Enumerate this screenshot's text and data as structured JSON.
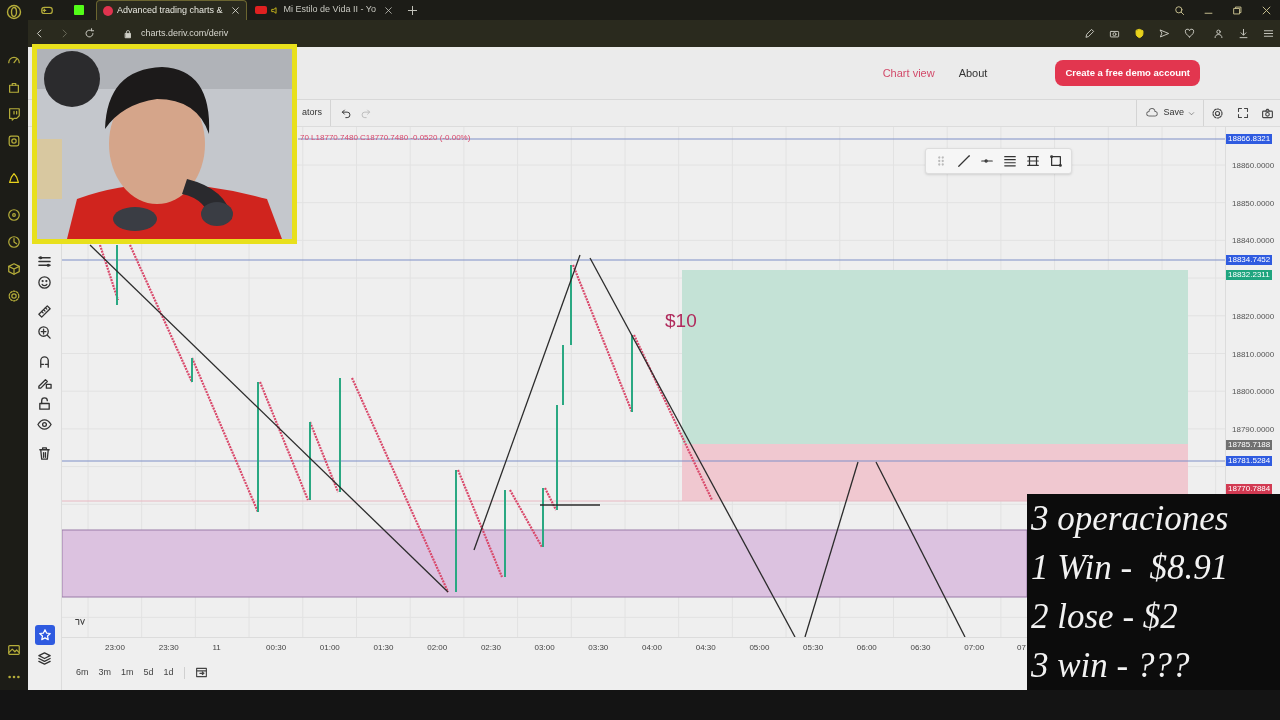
{
  "browser": {
    "tabs": [
      {
        "title": "Advanced trading charts &",
        "selected": true
      },
      {
        "title": "Mi Estilo de Vida II - Yo",
        "selected": false
      }
    ],
    "url": "charts.deriv.com/deriv"
  },
  "header": {
    "nav": [
      {
        "label": "Chart view",
        "selected": true
      },
      {
        "label": "About",
        "selected": false
      }
    ],
    "cta": "Create a free demo account"
  },
  "toolbar": {
    "indicators_label": "ators",
    "save_label": "Save"
  },
  "ohlc_text": "70 L18770.7480 C18770.7480 -0.0520 (-0.00%)",
  "chart": {
    "annotation": "$10",
    "price_ticks": [
      "18860.0000",
      "18850.0000",
      "18840.0000",
      "18820.0000",
      "18810.0000",
      "18800.0000",
      "18790.0000"
    ],
    "price_badges": [
      {
        "text": "18866.8321",
        "color": "#2f5be0"
      },
      {
        "text": "18834.7452",
        "color": "#2f5be0"
      },
      {
        "text": "18832.2311",
        "color": "#1fa57f"
      },
      {
        "text": "18785.7188",
        "color": "#707070"
      },
      {
        "text": "18781.5284",
        "color": "#2f5be0"
      },
      {
        "text": "18770.7884",
        "color": "#d23a52"
      }
    ],
    "time_ticks": [
      "23:00",
      "23:30",
      "11",
      "00:30",
      "01:00",
      "01:30",
      "02:00",
      "02:30",
      "03:00",
      "03:30",
      "04:00",
      "04:30",
      "05:00",
      "05:30",
      "06:00",
      "06:30",
      "07:00",
      "07"
    ]
  },
  "timeframes": [
    "6m",
    "3m",
    "1m",
    "5d",
    "1d"
  ],
  "overlay": {
    "lines": [
      "3 operaciones",
      "1 Win -  $8.91",
      "2 lose - $2",
      "3 win - ???"
    ]
  }
}
